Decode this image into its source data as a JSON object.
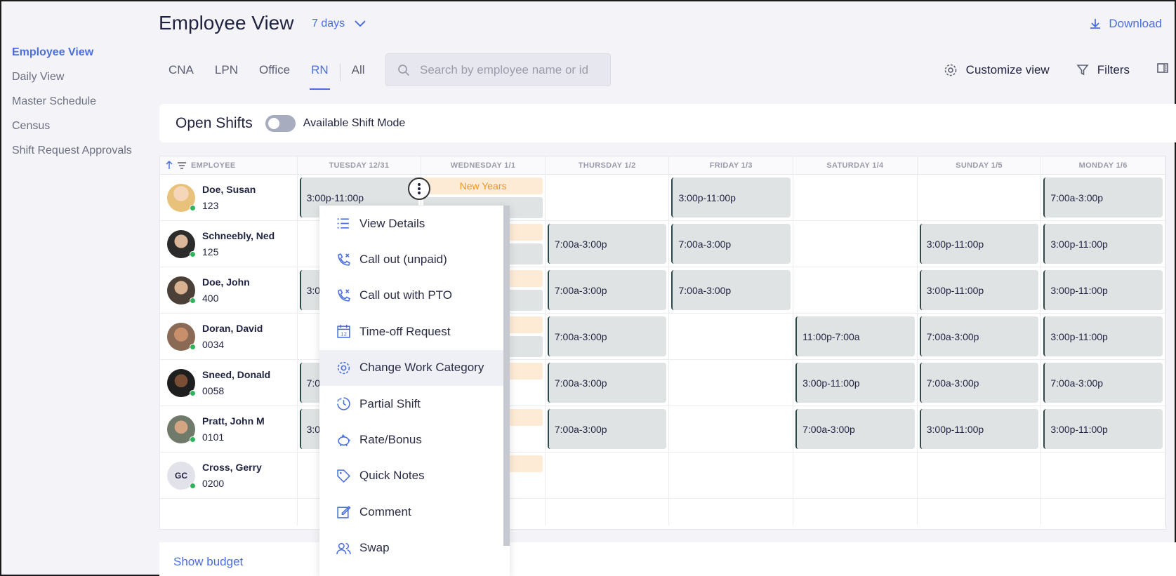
{
  "sidebar": {
    "items": [
      {
        "label": "Employee View"
      },
      {
        "label": "Daily View"
      },
      {
        "label": "Master Schedule"
      },
      {
        "label": "Census"
      },
      {
        "label": "Shift Request Approvals"
      }
    ]
  },
  "header": {
    "title": "Employee View",
    "range": "7 days",
    "download": "Download"
  },
  "tabs": [
    {
      "label": "CNA"
    },
    {
      "label": "LPN"
    },
    {
      "label": "Office"
    },
    {
      "label": "RN"
    },
    {
      "label": "All"
    }
  ],
  "search": {
    "placeholder": "Search by employee name or id"
  },
  "toolbar": {
    "customize": "Customize view",
    "filters": "Filters"
  },
  "open_shifts": {
    "title": "Open Shifts",
    "toggle_label": "Available Shift Mode"
  },
  "grid": {
    "employee_header": "EMPLOYEE",
    "days": [
      "TUESDAY 12/31",
      "WEDNESDAY 1/1",
      "THURSDAY 1/2",
      "FRIDAY 1/3",
      "SATURDAY 1/4",
      "SUNDAY 1/5",
      "MONDAY 1/6"
    ],
    "holiday": "New Years",
    "employees": [
      {
        "name": "Doe, Susan",
        "id": "123",
        "shifts": [
          "3:00p-11:00p",
          "",
          "",
          "3:00p-11:00p",
          "",
          "",
          "7:00a-3:00p"
        ]
      },
      {
        "name": "Schneebly, Ned",
        "id": "125",
        "shifts": [
          "",
          "",
          "7:00a-3:00p",
          "7:00a-3:00p",
          "",
          "3:00p-11:00p",
          "3:00p-11:00p"
        ]
      },
      {
        "name": "Doe, John",
        "id": "400",
        "shifts": [
          "3:0",
          "",
          "7:00a-3:00p",
          "7:00a-3:00p",
          "",
          "3:00p-11:00p",
          "3:00p-11:00p"
        ]
      },
      {
        "name": "Doran, David",
        "id": "0034",
        "shifts": [
          "",
          "",
          "7:00a-3:00p",
          "",
          "11:00p-7:00a",
          "7:00a-3:00p",
          "3:00p-11:00p"
        ]
      },
      {
        "name": "Sneed, Donald",
        "id": "0058",
        "shifts": [
          "7:0",
          "",
          "7:00a-3:00p",
          "",
          "3:00p-11:00p",
          "7:00a-3:00p",
          "7:00a-3:00p"
        ]
      },
      {
        "name": "Pratt, John M",
        "id": "0101",
        "shifts": [
          "3:0",
          "",
          "7:00a-3:00p",
          "",
          "7:00a-3:00p",
          "3:00p-11:00p",
          "3:00p-11:00p"
        ]
      },
      {
        "name": "Cross, Gerry",
        "id": "0200",
        "initials": "GC",
        "shifts": [
          "",
          "",
          "",
          "",
          "",
          "",
          ""
        ]
      }
    ]
  },
  "context_menu": {
    "items": [
      {
        "label": "View Details",
        "icon": "list-icon"
      },
      {
        "label": "Call out (unpaid)",
        "icon": "phone-x-icon"
      },
      {
        "label": "Call out with PTO",
        "icon": "phone-x-icon"
      },
      {
        "label": "Time-off Request",
        "icon": "calendar-icon"
      },
      {
        "label": "Change Work Category",
        "icon": "gear-icon"
      },
      {
        "label": "Partial Shift",
        "icon": "clock-partial-icon"
      },
      {
        "label": "Rate/Bonus",
        "icon": "piggy-bank-icon"
      },
      {
        "label": "Quick Notes",
        "icon": "tag-icon"
      },
      {
        "label": "Comment",
        "icon": "edit-icon"
      },
      {
        "label": "Swap",
        "icon": "users-icon"
      }
    ]
  },
  "footer": {
    "show_budget": "Show budget"
  },
  "colors": {
    "accent": "#4a6ee0",
    "shift_bg": "#dfe3e3",
    "holiday_bg": "#fdebd6",
    "holiday_text": "#e8962b",
    "online": "#2fb35b"
  }
}
